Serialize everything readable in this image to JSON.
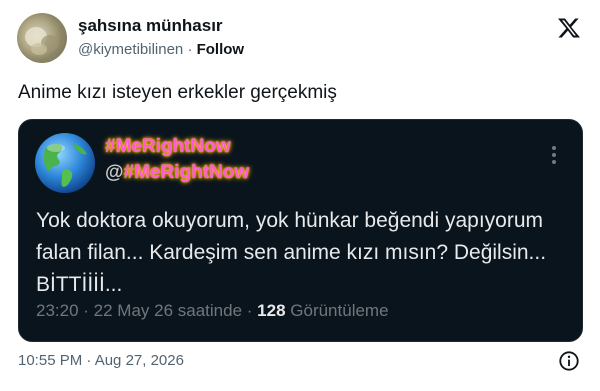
{
  "author": {
    "display_name": "şahsına münhasır",
    "handle": "@kiymetibilinen",
    "separator": "·",
    "follow_label": "Follow"
  },
  "tweet": {
    "text": "Anime kızı isteyen erkekler gerçekmiş",
    "timestamp": "10:55 PM · Aug 27, 2026"
  },
  "embedded_post": {
    "display_name": "#MeRightNow",
    "handle_prefix": "@",
    "handle": "#MeRightNow",
    "body": "Yok doktora okuyorum, yok hünkar beğendi yapıyorum falan filan... Kardeşim sen anime kızı mısın? Değilsin... BİTTİİİİ...",
    "meta_time": "23:20 · 22 May 26 saatinde ·",
    "views_count": "128",
    "views_label": "Görüntüleme"
  },
  "icons": {
    "brand": "x-logo-icon",
    "menu": "more-dots-icon",
    "info": "info-icon",
    "globe": "globe-icon"
  },
  "colors": {
    "embed_bg": "#0a141d",
    "neon_pink": "#ff5ad0",
    "neon_glow": "#ffd000",
    "muted": "#536471"
  }
}
